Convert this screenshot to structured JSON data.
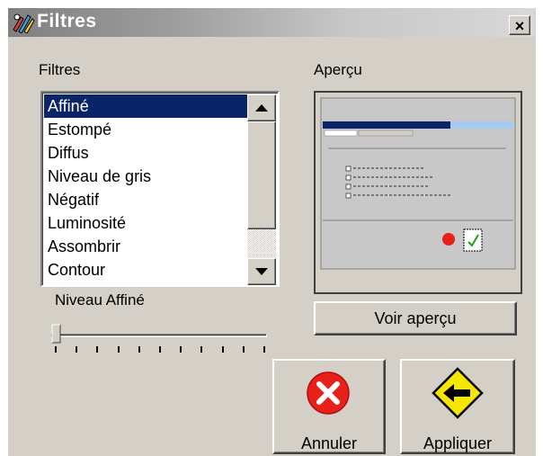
{
  "window": {
    "title": "Filtres",
    "close_glyph": "×",
    "app_icon": "brush-palette-icon"
  },
  "filters": {
    "label": "Filtres",
    "items": [
      "Affiné",
      "Estompé",
      "Diffus",
      "Niveau de gris",
      "Négatif",
      "Luminosité",
      "Assombrir",
      "Contour"
    ],
    "selected": "Affiné"
  },
  "preview": {
    "label": "Aperçu",
    "button_label": "Voir aperçu"
  },
  "level": {
    "label": "Niveau Affiné",
    "value_fraction": 0.0,
    "tick_count": 11
  },
  "actions": {
    "cancel_label": "Annuler",
    "cancel_icon": "cancel-x-icon",
    "apply_label": "Appliquer",
    "apply_icon": "arrow-left-sign-icon"
  },
  "colors": {
    "selection": "#0a246a",
    "face": "#d4d0c8",
    "cancel_red": "#e8201a",
    "apply_yellow": "#f7e600"
  }
}
